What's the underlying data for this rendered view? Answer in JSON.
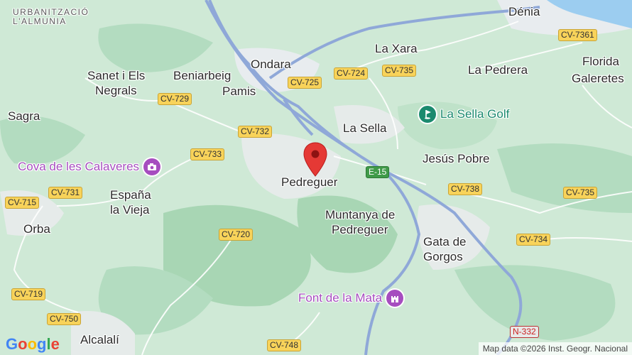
{
  "places": {
    "urbanitzacio_1": "URBANITZACIÓ",
    "urbanitzacio_2": "L'ALMUNIA",
    "denia": "Dénia",
    "ondara": "Ondara",
    "la_xara": "La Xara",
    "la_pedrera": "La Pedrera",
    "florida_1": "Florida",
    "florida_2": "Galeretes",
    "sanet_1": "Sanet i Els",
    "sanet_2": "Negrals",
    "beniarbeig": "Beniarbeig",
    "pamis": "Pamis",
    "sagra": "Sagra",
    "la_sella": "La Sella",
    "jesus_pobre": "Jesús Pobre",
    "pedreguer": "Pedreguer",
    "espana_1": "España",
    "espana_2": "la Vieja",
    "orba": "Orba",
    "muntanya_1": "Muntanya de",
    "muntanya_2": "Pedreguer",
    "gata_1": "Gata de",
    "gata_2": "Gorgos",
    "alcalali": "Alcalalí"
  },
  "roads": {
    "cv7361": "CV-7361",
    "cv724": "CV-724",
    "cv735a": "CV-735",
    "cv725": "CV-725",
    "cv729": "CV-729",
    "cv732": "CV-732",
    "cv733": "CV-733",
    "e15": "E-15",
    "cv731": "CV-731",
    "cv738": "CV-738",
    "cv735b": "CV-735",
    "cv715": "CV-715",
    "cv720": "CV-720",
    "cv734": "CV-734",
    "cv719": "CV-719",
    "cv750": "CV-750",
    "n332": "N-332",
    "cv748": "CV-748"
  },
  "pois": {
    "cova": {
      "label": "Cova de les Calaveres",
      "icon": "camera-icon",
      "color": "#a64dbf"
    },
    "sella_golf": {
      "label": "La Sella Golf",
      "icon": "golf-icon",
      "color": "#1a8a6e"
    },
    "font_mata": {
      "label": "Font de la Mata",
      "icon": "castle-icon",
      "color": "#a64dbf"
    }
  },
  "pin": {
    "icon": "location-pin-icon",
    "color": "#e53935"
  },
  "footer": {
    "logo": "Google",
    "attribution": "Map data ©2026 Inst. Geogr. Nacional"
  },
  "colors": {
    "land": "#cfe9d6",
    "mountain": "#a8d6b4",
    "urban": "#e8ecef",
    "sea": "#9ccdf0",
    "highway": "#8fa8d8",
    "road_shield": "#f8d35a"
  }
}
